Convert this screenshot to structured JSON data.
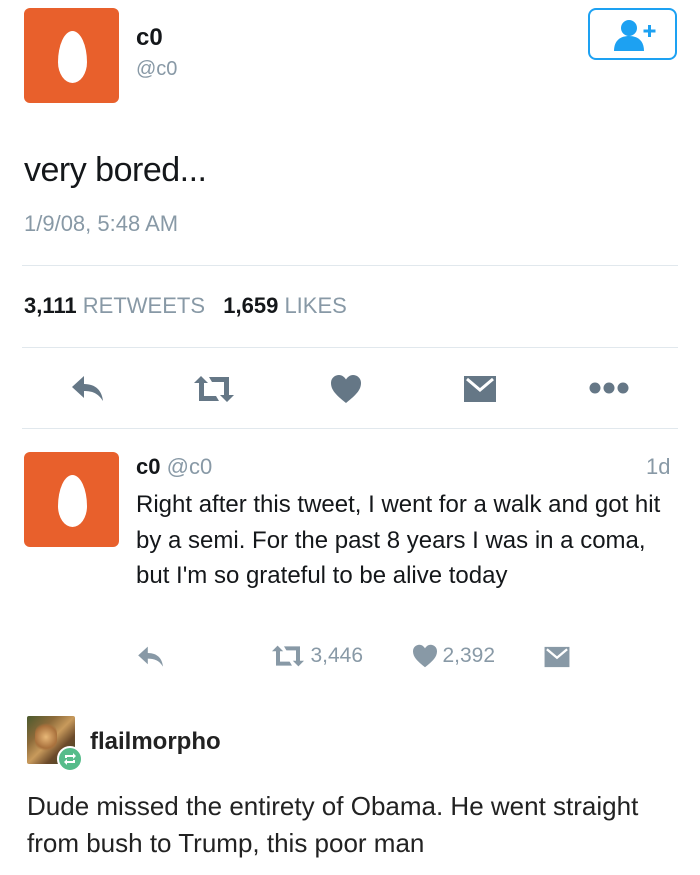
{
  "main_tweet": {
    "display_name": "c0",
    "handle": "@c0",
    "text": "very bored...",
    "timestamp": "1/9/08, 5:48 AM",
    "retweet_count": "3,111",
    "retweets_label": "RETWEETS",
    "like_count": "1,659",
    "likes_label": "LIKES"
  },
  "reply": {
    "display_name": "c0",
    "handle": "@c0",
    "age": "1d",
    "text": "Right after this tweet, I went for a walk and got hit by a semi. For the past 8 years I was in a coma, but I'm so grateful to be alive today",
    "retweet_count": "3,446",
    "like_count": "2,392"
  },
  "tumblr_post": {
    "username": "flailmorpho",
    "text": "Dude missed the entirety of Obama. He went straight from bush to Trump, this poor man"
  },
  "colors": {
    "avatar": "#e8602c",
    "accent": "#1da1f2",
    "icon_gray": "#657786",
    "muted_text": "#8899a6",
    "reblog_badge": "#56bc8a"
  }
}
